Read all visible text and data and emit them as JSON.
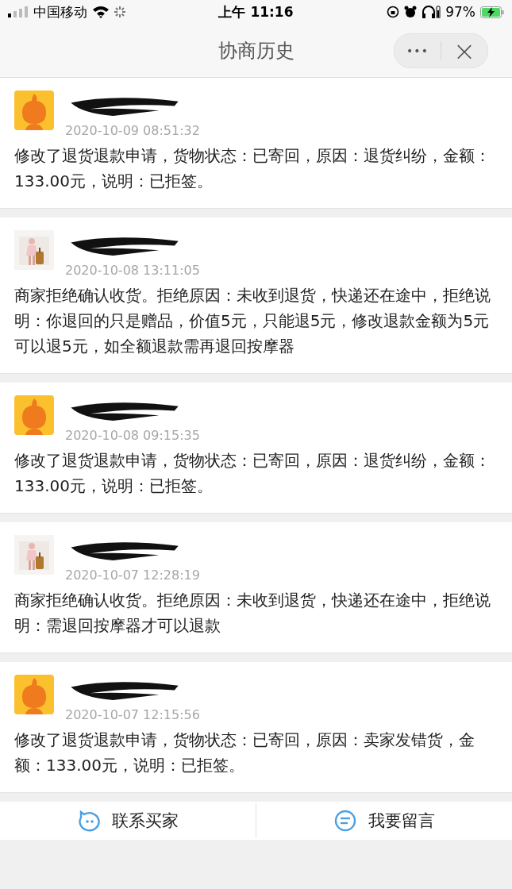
{
  "status_bar": {
    "carrier": "中国移动",
    "time": "上午 11:16",
    "battery": "97%"
  },
  "nav": {
    "title": "协商历史",
    "more": "•••",
    "close": "×"
  },
  "records": [
    {
      "kind": "mascot",
      "time": "2020-10-09 08:51:32",
      "text": "修改了退货退款申请，货物状态：已寄回，原因：退货纠纷，金额：133.00元，说明：已拒签。"
    },
    {
      "time": "2020-10-08 13:11:05",
      "text": "商家拒绝确认收货。拒绝原因：未收到退货，快递还在途中，拒绝说明：你退回的只是赠品，价值5元，只能退5元，修改退款金额为5元可以退5元，如全额退款需再退回按摩器"
    },
    {
      "kind": "mascot",
      "time": "2020-10-08 09:15:35",
      "text": "修改了退货退款申请，货物状态：已寄回，原因：退货纠纷，金额：133.00元，说明：已拒签。"
    },
    {
      "time": "2020-10-07 12:28:19",
      "text": "商家拒绝确认收货。拒绝原因：未收到退货，快递还在途中，拒绝说明：需退回按摩器才可以退款"
    },
    {
      "kind": "mascot",
      "time": "2020-10-07 12:15:56",
      "text": "修改了退货退款申请，货物状态：已寄回，原因：卖家发错货，金额：133.00元，说明：已拒签。"
    }
  ],
  "actions": [
    {
      "kind": "contact",
      "label": "联系买家"
    },
    {
      "kind": "message",
      "label": "我要留言"
    }
  ]
}
